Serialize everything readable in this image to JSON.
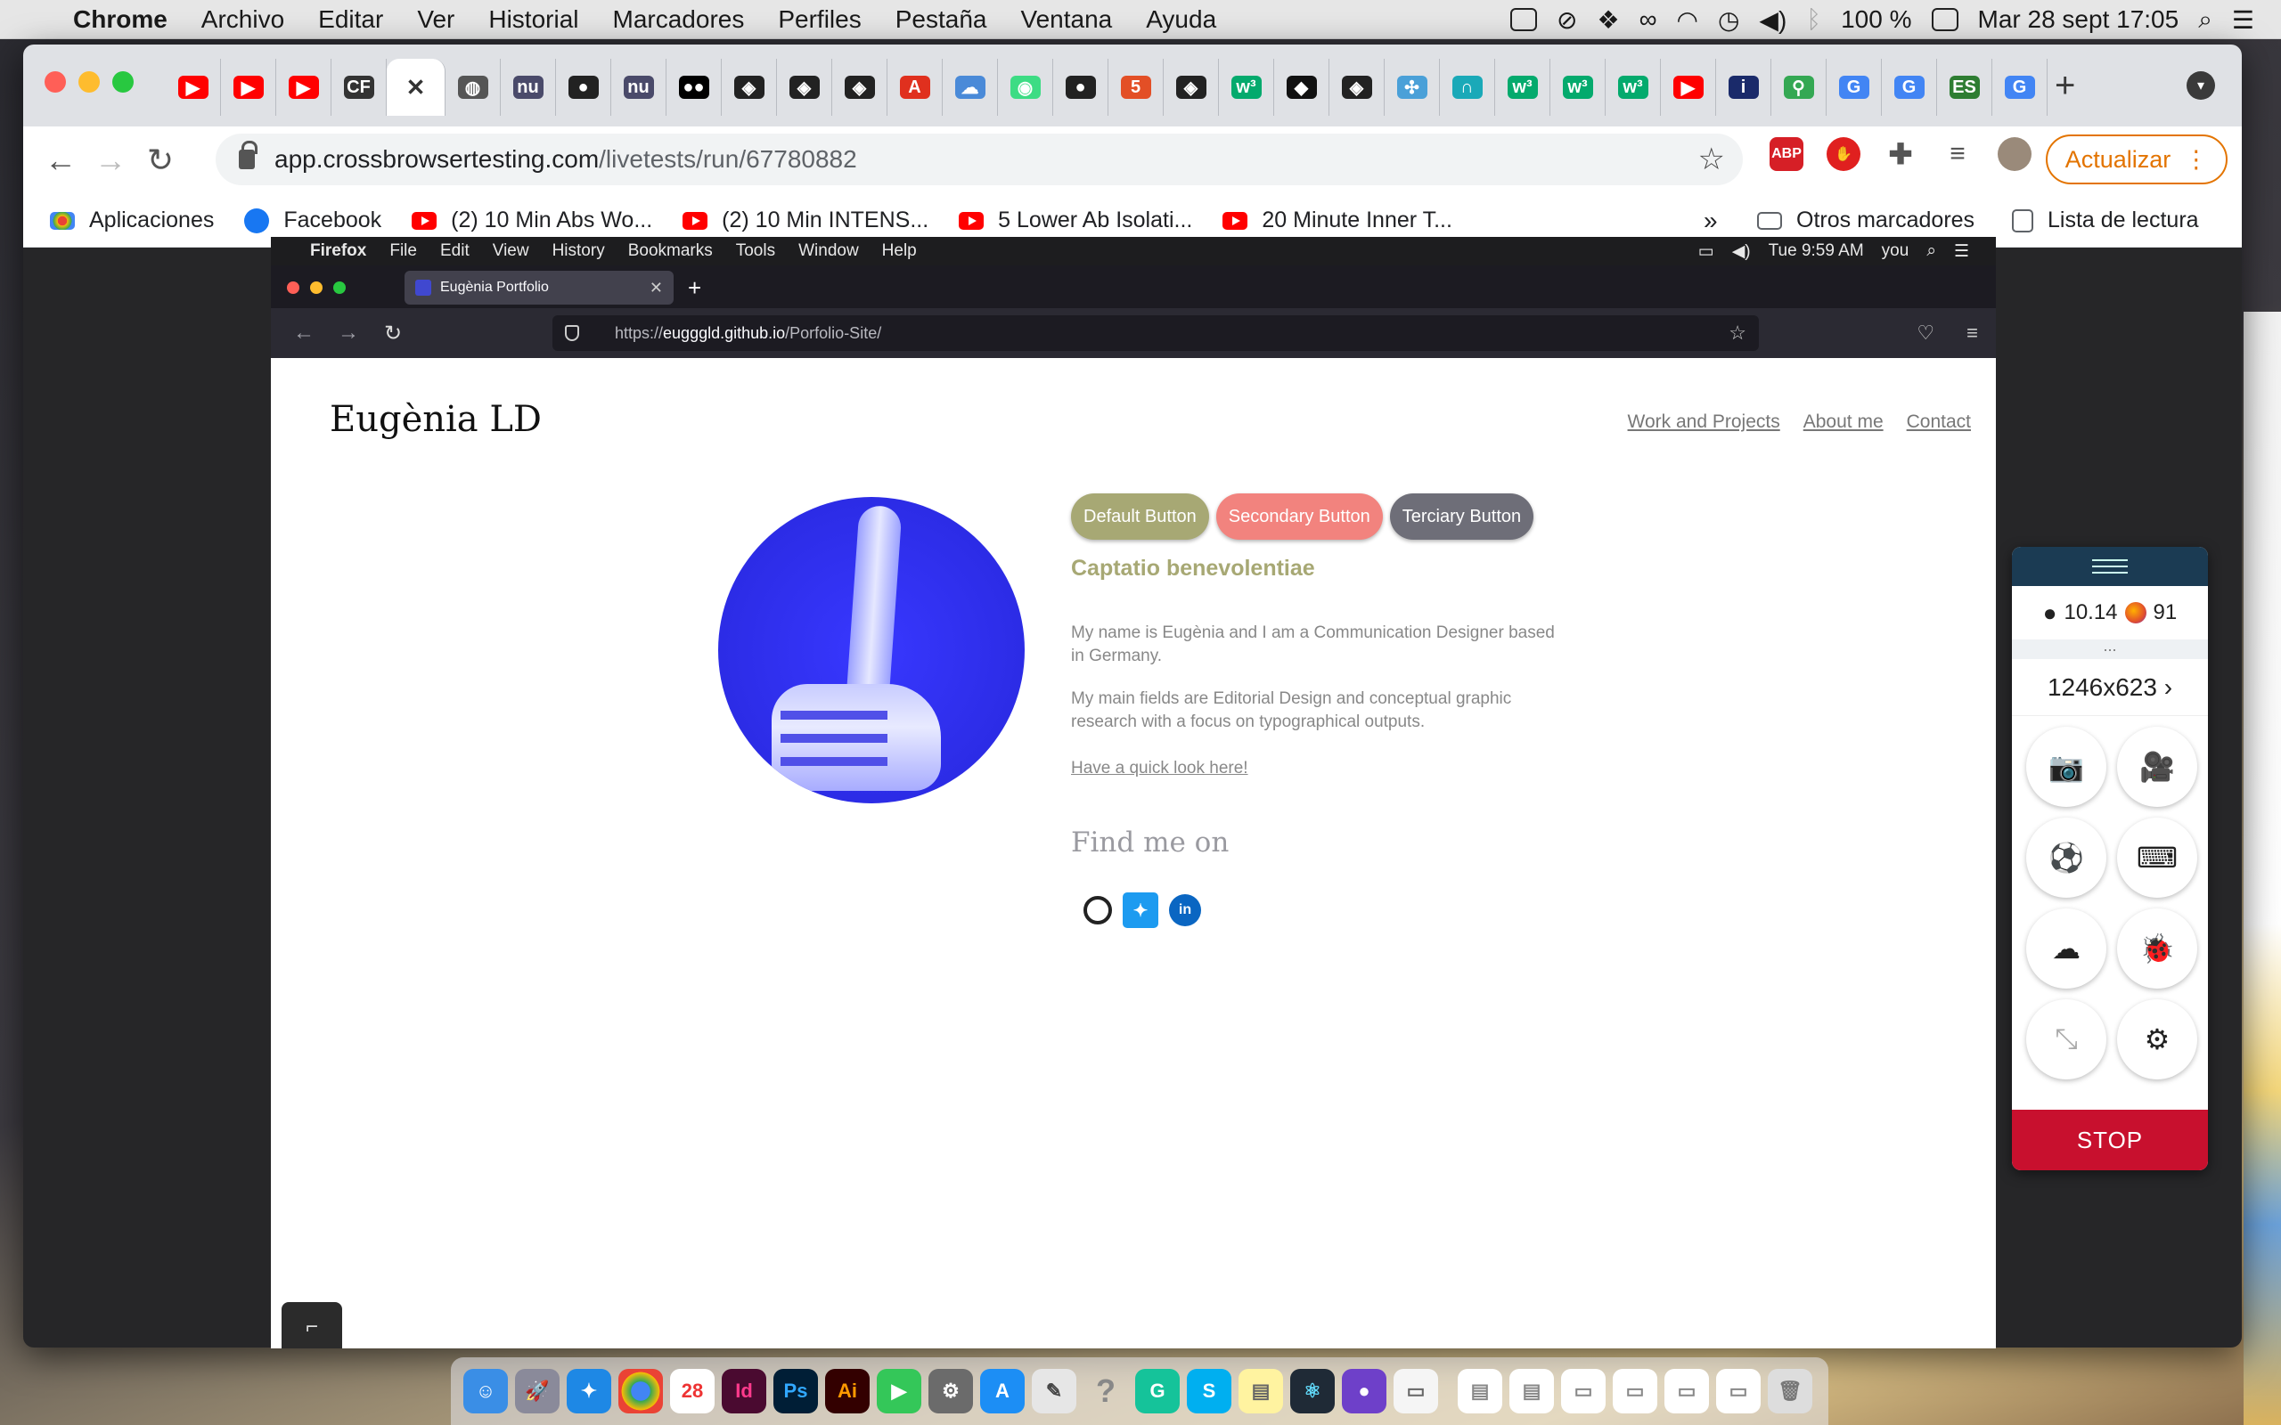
{
  "menubar": {
    "app": "Chrome",
    "items": [
      "Archivo",
      "Editar",
      "Ver",
      "Historial",
      "Marcadores",
      "Perfiles",
      "Pestaña",
      "Ventana",
      "Ayuda"
    ],
    "battery": "100 %",
    "datetime": "Mar 28 sept  17:05"
  },
  "chrome": {
    "tabs": [
      {
        "icon": "youtube-icon",
        "color": "#ff0000",
        "glyph": "▶"
      },
      {
        "icon": "youtube-icon",
        "color": "#ff0000",
        "glyph": "▶"
      },
      {
        "icon": "youtube-icon",
        "color": "#ff0000",
        "glyph": "▶"
      },
      {
        "icon": "cf-icon",
        "color": "#333333",
        "glyph": "CF"
      },
      {
        "icon": "close-icon",
        "color": "#ffffff",
        "glyph": "✕",
        "active": true
      },
      {
        "icon": "globe-icon",
        "color": "#555555",
        "glyph": "◍"
      },
      {
        "icon": "nu-icon",
        "color": "#4a4a6a",
        "glyph": "nu"
      },
      {
        "icon": "github-icon",
        "color": "#222222",
        "glyph": "●"
      },
      {
        "icon": "nu-icon",
        "color": "#4a4a6a",
        "glyph": "nu"
      },
      {
        "icon": "medium-icon",
        "color": "#000000",
        "glyph": "●●"
      },
      {
        "icon": "codepen-icon",
        "color": "#222222",
        "glyph": "◈"
      },
      {
        "icon": "codepen-icon",
        "color": "#222222",
        "glyph": "◈"
      },
      {
        "icon": "codepen-icon",
        "color": "#222222",
        "glyph": "◈"
      },
      {
        "icon": "acrobat-icon",
        "color": "#e0301e",
        "glyph": "A"
      },
      {
        "icon": "cloud-icon",
        "color": "#4a8ad8",
        "glyph": "☁"
      },
      {
        "icon": "android-icon",
        "color": "#3ddc84",
        "glyph": "◉"
      },
      {
        "icon": "github-icon",
        "color": "#222222",
        "glyph": "●"
      },
      {
        "icon": "html5-icon",
        "color": "#e34f26",
        "glyph": "5"
      },
      {
        "icon": "codepen-icon",
        "color": "#222222",
        "glyph": "◈"
      },
      {
        "icon": "w3-icon",
        "color": "#04aa6d",
        "glyph": "w³"
      },
      {
        "icon": "stackby-icon",
        "color": "#111111",
        "glyph": "◆"
      },
      {
        "icon": "codepen-icon",
        "color": "#222222",
        "glyph": "◈"
      },
      {
        "icon": "antenna-icon",
        "color": "#4aa0d8",
        "glyph": "✣"
      },
      {
        "icon": "magnet-icon",
        "color": "#1aa9b8",
        "glyph": "∩"
      },
      {
        "icon": "w3-icon",
        "color": "#04aa6d",
        "glyph": "w³"
      },
      {
        "icon": "w3-icon",
        "color": "#04aa6d",
        "glyph": "w³"
      },
      {
        "icon": "w3-icon",
        "color": "#04aa6d",
        "glyph": "w³"
      },
      {
        "icon": "youtube-icon",
        "color": "#ff0000",
        "glyph": "▶"
      },
      {
        "icon": "circle-info-icon",
        "color": "#1a2a6a",
        "glyph": "i"
      },
      {
        "icon": "maps-icon",
        "color": "#34a853",
        "glyph": "⚲"
      },
      {
        "icon": "google-icon",
        "color": "#4285f4",
        "glyph": "G"
      },
      {
        "icon": "google-icon",
        "color": "#4285f4",
        "glyph": "G"
      },
      {
        "icon": "es-icon",
        "color": "#2e7d32",
        "glyph": "ES"
      },
      {
        "icon": "google-icon",
        "color": "#4285f4",
        "glyph": "G"
      }
    ],
    "url_host": "app.crossbrowsertesting.com",
    "url_path": "/livetests/run/67780882",
    "update_label": "Actualizar",
    "bookmarks": [
      {
        "label": "Aplicaciones",
        "icon": "apps-grid-icon"
      },
      {
        "label": "Facebook",
        "icon": "facebook-icon"
      },
      {
        "label": "(2) 10 Min Abs Wo...",
        "icon": "youtube-icon"
      },
      {
        "label": "(2) 10 Min INTENS...",
        "icon": "youtube-icon"
      },
      {
        "label": "5 Lower Ab Isolati...",
        "icon": "youtube-icon"
      },
      {
        "label": "20 Minute Inner T...",
        "icon": "youtube-icon"
      }
    ],
    "bookmarks_more": "»",
    "other_bookmarks": "Otros marcadores",
    "reading_list": "Lista de lectura"
  },
  "remote": {
    "menubar": {
      "app": "Firefox",
      "items": [
        "File",
        "Edit",
        "View",
        "History",
        "Bookmarks",
        "Tools",
        "Window",
        "Help"
      ],
      "time": "Tue 9:59 AM",
      "user": "you"
    },
    "tab_title": "Eugènia Portfolio",
    "url_prefix": "https://",
    "url_domain": "eugggld.github.io",
    "url_path": "/Porfolio-Site/"
  },
  "site": {
    "title": "Eugènia LD",
    "nav": [
      "Work and Projects",
      "About me",
      "Contact"
    ],
    "buttons": [
      {
        "label": "Default Button",
        "color": "#a7a874"
      },
      {
        "label": "Secondary Button",
        "color": "#f2837e"
      },
      {
        "label": "Terciary Button",
        "color": "#6e6e78"
      }
    ],
    "heading": "Captatio benevolentiae",
    "para1": "My name is Eugènia and I am a Communication Designer based in Germany.",
    "para2": "My main fields are Editorial Design and conceptual graphic research with a focus on typographical outputs.",
    "link": "Have a quick look here!",
    "find_me": "Find me on",
    "social": [
      "github-icon",
      "twitter-icon",
      "linkedin-icon"
    ]
  },
  "panel": {
    "os_version": "10.14",
    "browser_version": "91",
    "resolution": "1246x623",
    "stop_label": "STOP"
  },
  "colors": {
    "accent_chrome_update": "#e37400",
    "stop": "#c8102e",
    "panel_header": "#1b3b53"
  }
}
